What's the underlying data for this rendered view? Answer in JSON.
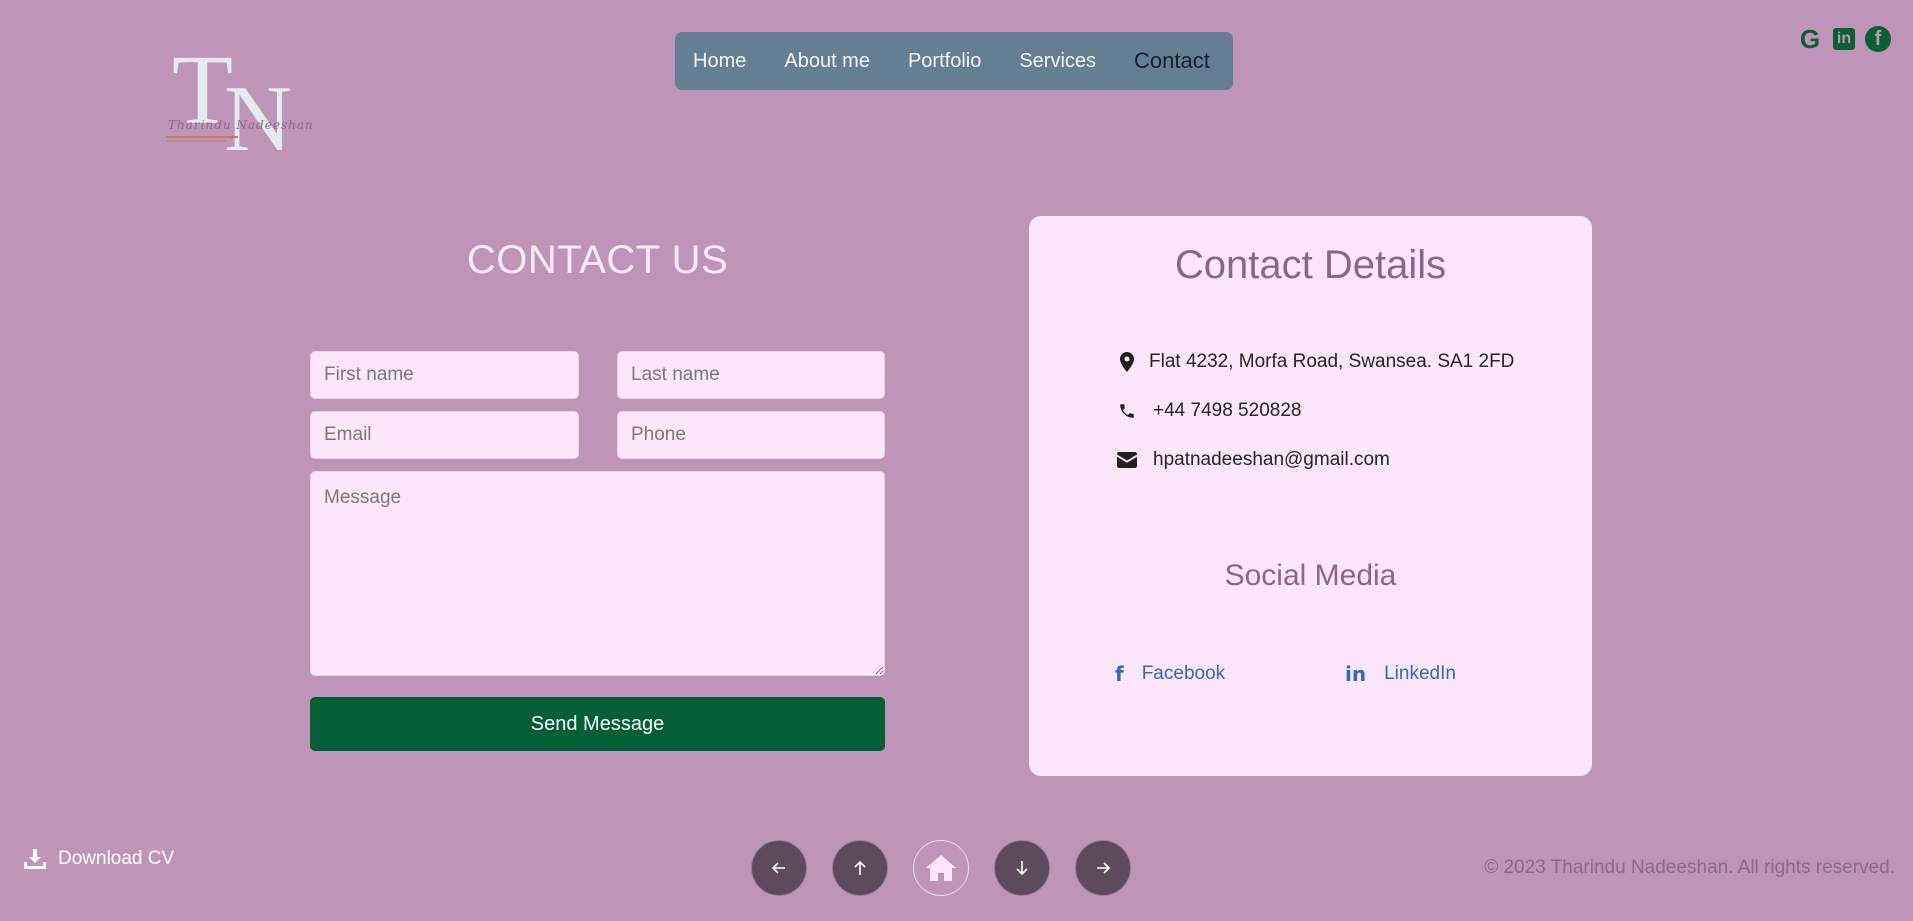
{
  "logo": {
    "letters": "TN",
    "letter_t": "T",
    "letter_n": "N",
    "script_name": "Tharindu Nadeeshan"
  },
  "nav": {
    "items": [
      {
        "label": "Home"
      },
      {
        "label": "About me"
      },
      {
        "label": "Portfolio"
      },
      {
        "label": "Services"
      },
      {
        "label": "Contact",
        "active": true
      }
    ]
  },
  "top_social": {
    "icons": [
      "google-icon",
      "linkedin-icon",
      "facebook-icon"
    ],
    "google_glyph": "G",
    "linkedin_glyph": "in",
    "facebook_glyph": "f",
    "color": "#0b5f34"
  },
  "contact_form": {
    "title": "CONTACT US",
    "first_name_placeholder": "First name",
    "last_name_placeholder": "Last name",
    "email_placeholder": "Email",
    "phone_placeholder": "Phone",
    "message_placeholder": "Message",
    "send_label": "Send Message",
    "button_color": "#035f36"
  },
  "contact_details": {
    "title": "Contact Details",
    "address": "Flat 4232, Morfa Road, Swansea. SA1 2FD",
    "phone": "+44 7498 520828",
    "email": "hpatnadeeshan@gmail.com",
    "social_title": "Social Media",
    "facebook_label": "Facebook",
    "linkedin_label": "LinkedIn",
    "facebook_glyph": "f",
    "linkedin_glyph": "in"
  },
  "footer": {
    "download_label": "Download CV",
    "copyright": "© 2023 Tharindu Nadeeshan. All rights reserved.",
    "nav_buttons": [
      "arrow-left-icon",
      "arrow-up-icon",
      "home-icon",
      "arrow-down-icon",
      "arrow-right-icon"
    ]
  },
  "colors": {
    "background": "#bf94b9",
    "nav_bg": "#657f92",
    "card_bg": "#fde6fb",
    "accent_link": "#2a6bc3"
  }
}
